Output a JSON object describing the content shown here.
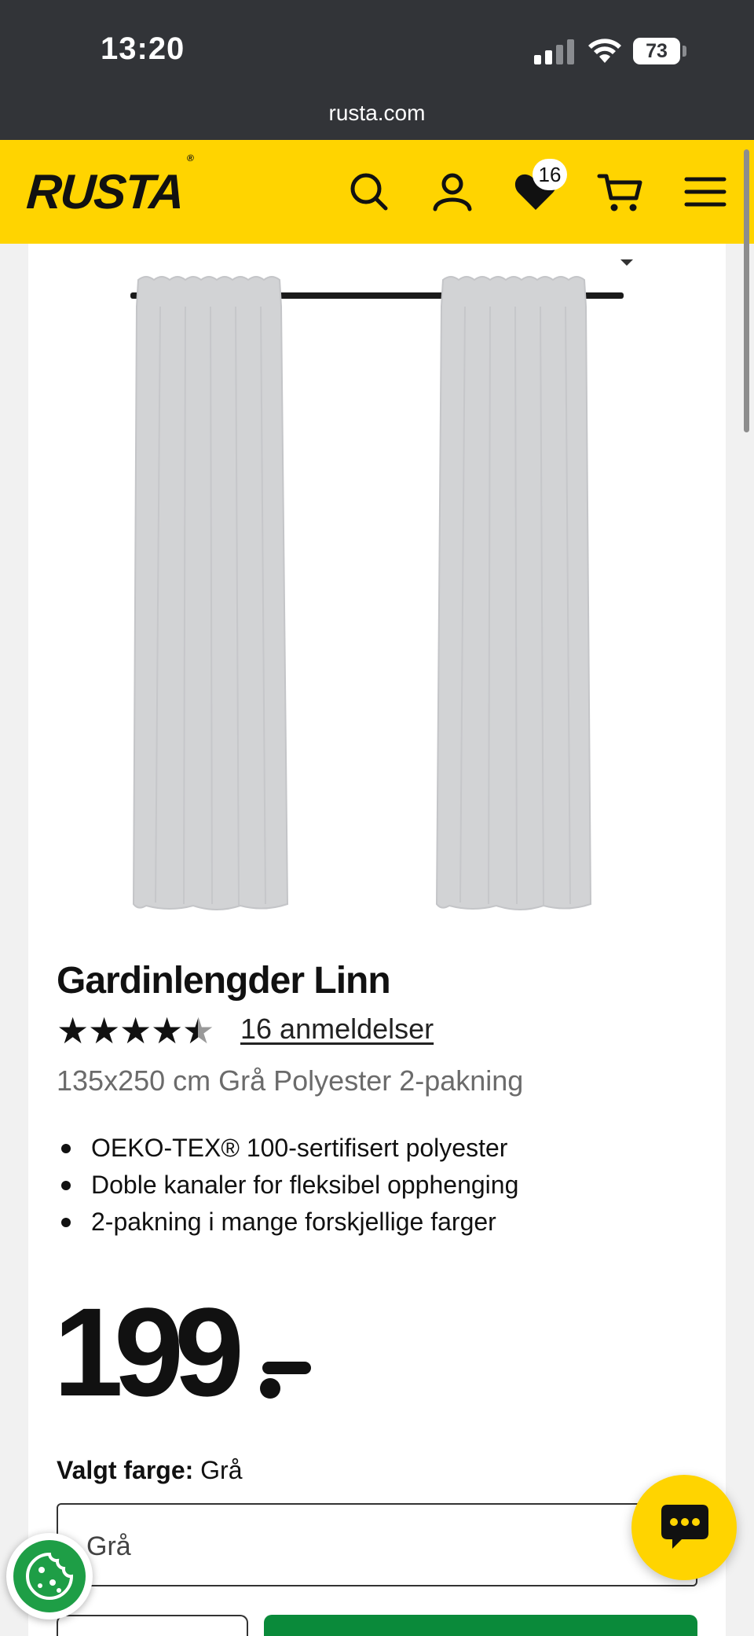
{
  "status_bar": {
    "time": "13:20",
    "battery": "73",
    "url": "rusta.com"
  },
  "header": {
    "logo": "RUSTA",
    "logo_mark": "®",
    "icons": [
      "search-icon",
      "account-icon",
      "heart-icon",
      "cart-icon",
      "menu-icon"
    ],
    "wishlist_count": "16",
    "brand_color": "#ffd400"
  },
  "product": {
    "title": "Gardinlengder Linn",
    "rating": 4.5,
    "rating_max": 5,
    "reviews_link": "16 anmeldelser",
    "subtitle": "135x250 cm Grå Polyester 2-pakning",
    "features": [
      "OEKO-TEX® 100-sertifisert polyester",
      "Doble kanaler for fleksibel opphenging",
      "2-pakning i mange forskjellige farger"
    ],
    "price": "199",
    "selected_color_label": "Valgt farge:",
    "selected_color_value": "Grå",
    "color_select_value": "Grå"
  },
  "colors": {
    "buy_button": "#0a8a3a",
    "cookie_button": "#1e9e46",
    "status_bar": "#323438"
  }
}
